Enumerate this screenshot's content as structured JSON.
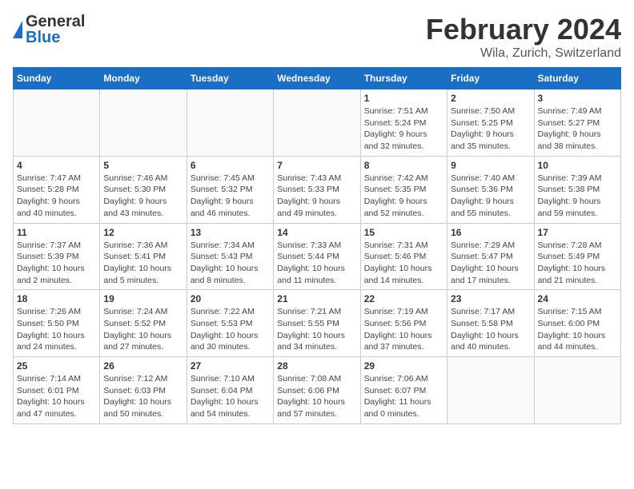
{
  "header": {
    "logo_general": "General",
    "logo_blue": "Blue",
    "title": "February 2024",
    "subtitle": "Wila, Zurich, Switzerland"
  },
  "days_of_week": [
    "Sunday",
    "Monday",
    "Tuesday",
    "Wednesday",
    "Thursday",
    "Friday",
    "Saturday"
  ],
  "weeks": [
    [
      {
        "day": "",
        "info": ""
      },
      {
        "day": "",
        "info": ""
      },
      {
        "day": "",
        "info": ""
      },
      {
        "day": "",
        "info": ""
      },
      {
        "day": "1",
        "info": "Sunrise: 7:51 AM\nSunset: 5:24 PM\nDaylight: 9 hours\nand 32 minutes."
      },
      {
        "day": "2",
        "info": "Sunrise: 7:50 AM\nSunset: 5:25 PM\nDaylight: 9 hours\nand 35 minutes."
      },
      {
        "day": "3",
        "info": "Sunrise: 7:49 AM\nSunset: 5:27 PM\nDaylight: 9 hours\nand 38 minutes."
      }
    ],
    [
      {
        "day": "4",
        "info": "Sunrise: 7:47 AM\nSunset: 5:28 PM\nDaylight: 9 hours\nand 40 minutes."
      },
      {
        "day": "5",
        "info": "Sunrise: 7:46 AM\nSunset: 5:30 PM\nDaylight: 9 hours\nand 43 minutes."
      },
      {
        "day": "6",
        "info": "Sunrise: 7:45 AM\nSunset: 5:32 PM\nDaylight: 9 hours\nand 46 minutes."
      },
      {
        "day": "7",
        "info": "Sunrise: 7:43 AM\nSunset: 5:33 PM\nDaylight: 9 hours\nand 49 minutes."
      },
      {
        "day": "8",
        "info": "Sunrise: 7:42 AM\nSunset: 5:35 PM\nDaylight: 9 hours\nand 52 minutes."
      },
      {
        "day": "9",
        "info": "Sunrise: 7:40 AM\nSunset: 5:36 PM\nDaylight: 9 hours\nand 55 minutes."
      },
      {
        "day": "10",
        "info": "Sunrise: 7:39 AM\nSunset: 5:38 PM\nDaylight: 9 hours\nand 59 minutes."
      }
    ],
    [
      {
        "day": "11",
        "info": "Sunrise: 7:37 AM\nSunset: 5:39 PM\nDaylight: 10 hours\nand 2 minutes."
      },
      {
        "day": "12",
        "info": "Sunrise: 7:36 AM\nSunset: 5:41 PM\nDaylight: 10 hours\nand 5 minutes."
      },
      {
        "day": "13",
        "info": "Sunrise: 7:34 AM\nSunset: 5:43 PM\nDaylight: 10 hours\nand 8 minutes."
      },
      {
        "day": "14",
        "info": "Sunrise: 7:33 AM\nSunset: 5:44 PM\nDaylight: 10 hours\nand 11 minutes."
      },
      {
        "day": "15",
        "info": "Sunrise: 7:31 AM\nSunset: 5:46 PM\nDaylight: 10 hours\nand 14 minutes."
      },
      {
        "day": "16",
        "info": "Sunrise: 7:29 AM\nSunset: 5:47 PM\nDaylight: 10 hours\nand 17 minutes."
      },
      {
        "day": "17",
        "info": "Sunrise: 7:28 AM\nSunset: 5:49 PM\nDaylight: 10 hours\nand 21 minutes."
      }
    ],
    [
      {
        "day": "18",
        "info": "Sunrise: 7:26 AM\nSunset: 5:50 PM\nDaylight: 10 hours\nand 24 minutes."
      },
      {
        "day": "19",
        "info": "Sunrise: 7:24 AM\nSunset: 5:52 PM\nDaylight: 10 hours\nand 27 minutes."
      },
      {
        "day": "20",
        "info": "Sunrise: 7:22 AM\nSunset: 5:53 PM\nDaylight: 10 hours\nand 30 minutes."
      },
      {
        "day": "21",
        "info": "Sunrise: 7:21 AM\nSunset: 5:55 PM\nDaylight: 10 hours\nand 34 minutes."
      },
      {
        "day": "22",
        "info": "Sunrise: 7:19 AM\nSunset: 5:56 PM\nDaylight: 10 hours\nand 37 minutes."
      },
      {
        "day": "23",
        "info": "Sunrise: 7:17 AM\nSunset: 5:58 PM\nDaylight: 10 hours\nand 40 minutes."
      },
      {
        "day": "24",
        "info": "Sunrise: 7:15 AM\nSunset: 6:00 PM\nDaylight: 10 hours\nand 44 minutes."
      }
    ],
    [
      {
        "day": "25",
        "info": "Sunrise: 7:14 AM\nSunset: 6:01 PM\nDaylight: 10 hours\nand 47 minutes."
      },
      {
        "day": "26",
        "info": "Sunrise: 7:12 AM\nSunset: 6:03 PM\nDaylight: 10 hours\nand 50 minutes."
      },
      {
        "day": "27",
        "info": "Sunrise: 7:10 AM\nSunset: 6:04 PM\nDaylight: 10 hours\nand 54 minutes."
      },
      {
        "day": "28",
        "info": "Sunrise: 7:08 AM\nSunset: 6:06 PM\nDaylight: 10 hours\nand 57 minutes."
      },
      {
        "day": "29",
        "info": "Sunrise: 7:06 AM\nSunset: 6:07 PM\nDaylight: 11 hours\nand 0 minutes."
      },
      {
        "day": "",
        "info": ""
      },
      {
        "day": "",
        "info": ""
      }
    ]
  ]
}
